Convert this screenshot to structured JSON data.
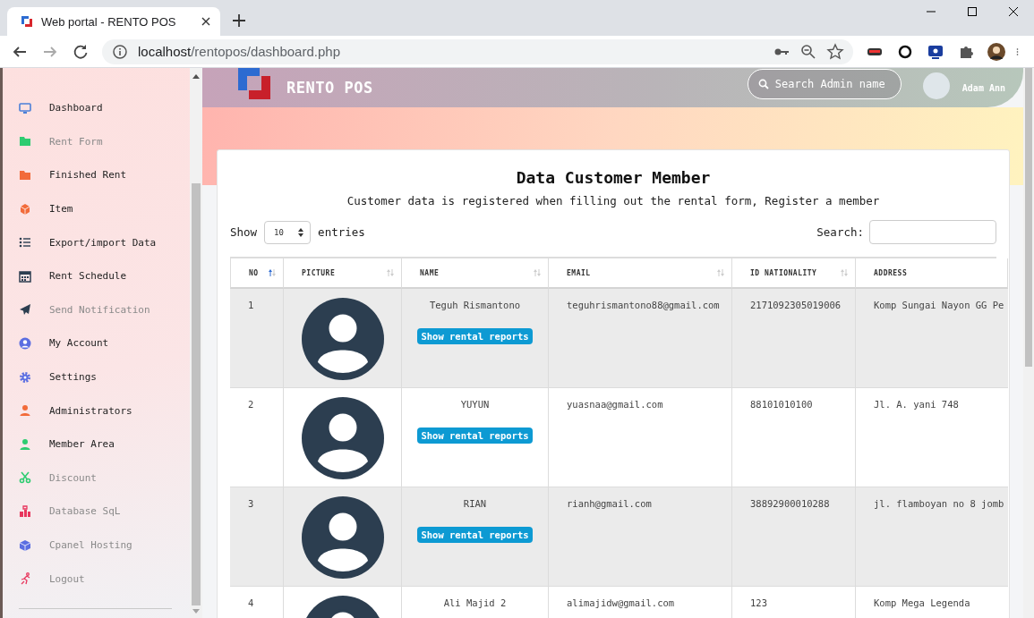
{
  "browser": {
    "tab_title": "Web portal - RENTO POS",
    "url_host": "localhost",
    "url_path": "/rentopos/dashboard.php"
  },
  "sidebar": {
    "items": [
      {
        "label": "Dashboard",
        "dimmed": false
      },
      {
        "label": "Rent Form",
        "dimmed": true
      },
      {
        "label": "Finished Rent",
        "dimmed": false
      },
      {
        "label": "Item",
        "dimmed": false
      },
      {
        "label": "Export/import Data",
        "dimmed": false
      },
      {
        "label": "Rent Schedule",
        "dimmed": false
      },
      {
        "label": "Send Notification",
        "dimmed": true
      },
      {
        "label": "My Account",
        "dimmed": false
      },
      {
        "label": "Settings",
        "dimmed": false
      },
      {
        "label": "Administrators",
        "dimmed": false
      },
      {
        "label": "Member Area",
        "dimmed": false
      },
      {
        "label": "Discount",
        "dimmed": true
      },
      {
        "label": "Database SqL",
        "dimmed": true
      },
      {
        "label": "Cpanel Hosting",
        "dimmed": true
      },
      {
        "label": "Logout",
        "dimmed": true
      }
    ]
  },
  "header": {
    "brand": "RENTO POS",
    "search": {
      "placeholder": "Search Admin name"
    },
    "user": "Adam Ann"
  },
  "card": {
    "title": "Data Customer Member",
    "subtitle": "Customer data is registered when filling out the rental form, Register a member",
    "show_label": "Show",
    "page_size": "10",
    "entries_label": "entries",
    "search_label": "Search:"
  },
  "table": {
    "columns": [
      {
        "label": "NO",
        "kind": "sorted"
      },
      {
        "label": "PICTURE",
        "kind": "sortable"
      },
      {
        "label": "NAME",
        "kind": "sortable"
      },
      {
        "label": "EMAIL",
        "kind": "sortable"
      },
      {
        "label": "ID NATIONALITY",
        "kind": "sortable"
      },
      {
        "label": "ADDRESS",
        "kind": "plain"
      }
    ],
    "rows": [
      {
        "no": "1",
        "name": "Teguh Rismantono",
        "button": "Show rental reports",
        "email": "teguhrismantono88@gmail.com",
        "id_nationality": "2171092305019006",
        "address": "Komp Sungai Nayon GG Pe"
      },
      {
        "no": "2",
        "name": "YUYUN",
        "button": "Show rental reports",
        "email": "yuasnaa@gmail.com",
        "id_nationality": "88101010100",
        "address": "Jl. A. yani 748"
      },
      {
        "no": "3",
        "name": "RIAN",
        "button": "Show rental reports",
        "email": "rianh@gmail.com",
        "id_nationality": "38892900010288",
        "address": "jl. flamboyan no 8 jomb"
      },
      {
        "no": "4",
        "name": "Ali Majid 2",
        "email": "alimajidw@gmail.com",
        "id_nationality": "123",
        "address": "Komp Mega Legenda"
      }
    ]
  }
}
